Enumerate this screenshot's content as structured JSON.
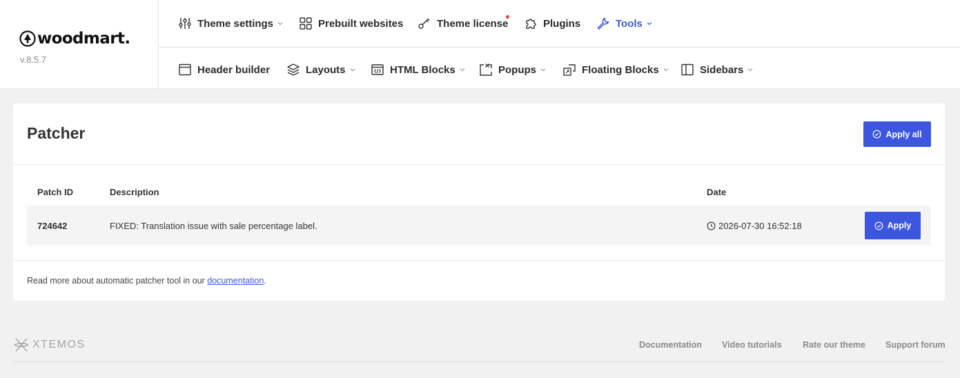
{
  "brand": {
    "logo_text": "woodmart.",
    "version": "v.8.5.7"
  },
  "nav": {
    "row1": [
      {
        "label": "Theme settings",
        "icon": "sliders-icon",
        "dropdown": true
      },
      {
        "label": "Prebuilt websites",
        "icon": "grid-icon",
        "dropdown": false
      },
      {
        "label": "Theme license",
        "icon": "key-icon",
        "dropdown": false,
        "notification": true
      },
      {
        "label": "Plugins",
        "icon": "puzzle-icon",
        "dropdown": false
      },
      {
        "label": "Tools",
        "icon": "wrench-icon",
        "dropdown": true,
        "active": true
      }
    ],
    "row2": [
      {
        "label": "Header builder",
        "icon": "header-layout-icon",
        "dropdown": false
      },
      {
        "label": "Layouts",
        "icon": "layers-icon",
        "dropdown": true
      },
      {
        "label": "HTML Blocks",
        "icon": "code-block-icon",
        "dropdown": true
      },
      {
        "label": "Popups",
        "icon": "popup-icon",
        "dropdown": true
      },
      {
        "label": "Floating Blocks",
        "icon": "floating-block-icon",
        "dropdown": true
      },
      {
        "label": "Sidebars",
        "icon": "sidebar-icon",
        "dropdown": true
      }
    ]
  },
  "patcher": {
    "title": "Patcher",
    "apply_all_label": "Apply all",
    "columns": [
      "Patch ID",
      "Description",
      "Date"
    ],
    "patches": [
      {
        "id": "724642",
        "description": "FIXED: Translation issue with sale percentage label.",
        "date": "2026-07-30 16:52:18",
        "action_label": "Apply"
      }
    ],
    "note_prefix": "Read more about automatic patcher tool in our ",
    "note_link": "documentation",
    "note_suffix": "."
  },
  "footer": {
    "logo_text": "XTEMOS",
    "links": [
      "Documentation",
      "Video tutorials",
      "Rate our theme",
      "Support forum"
    ]
  },
  "colors": {
    "accent": "#3d56e0",
    "active_nav": "#3d5ad6",
    "notification_dot": "#e63e3e",
    "background": "#f1f1f1"
  }
}
